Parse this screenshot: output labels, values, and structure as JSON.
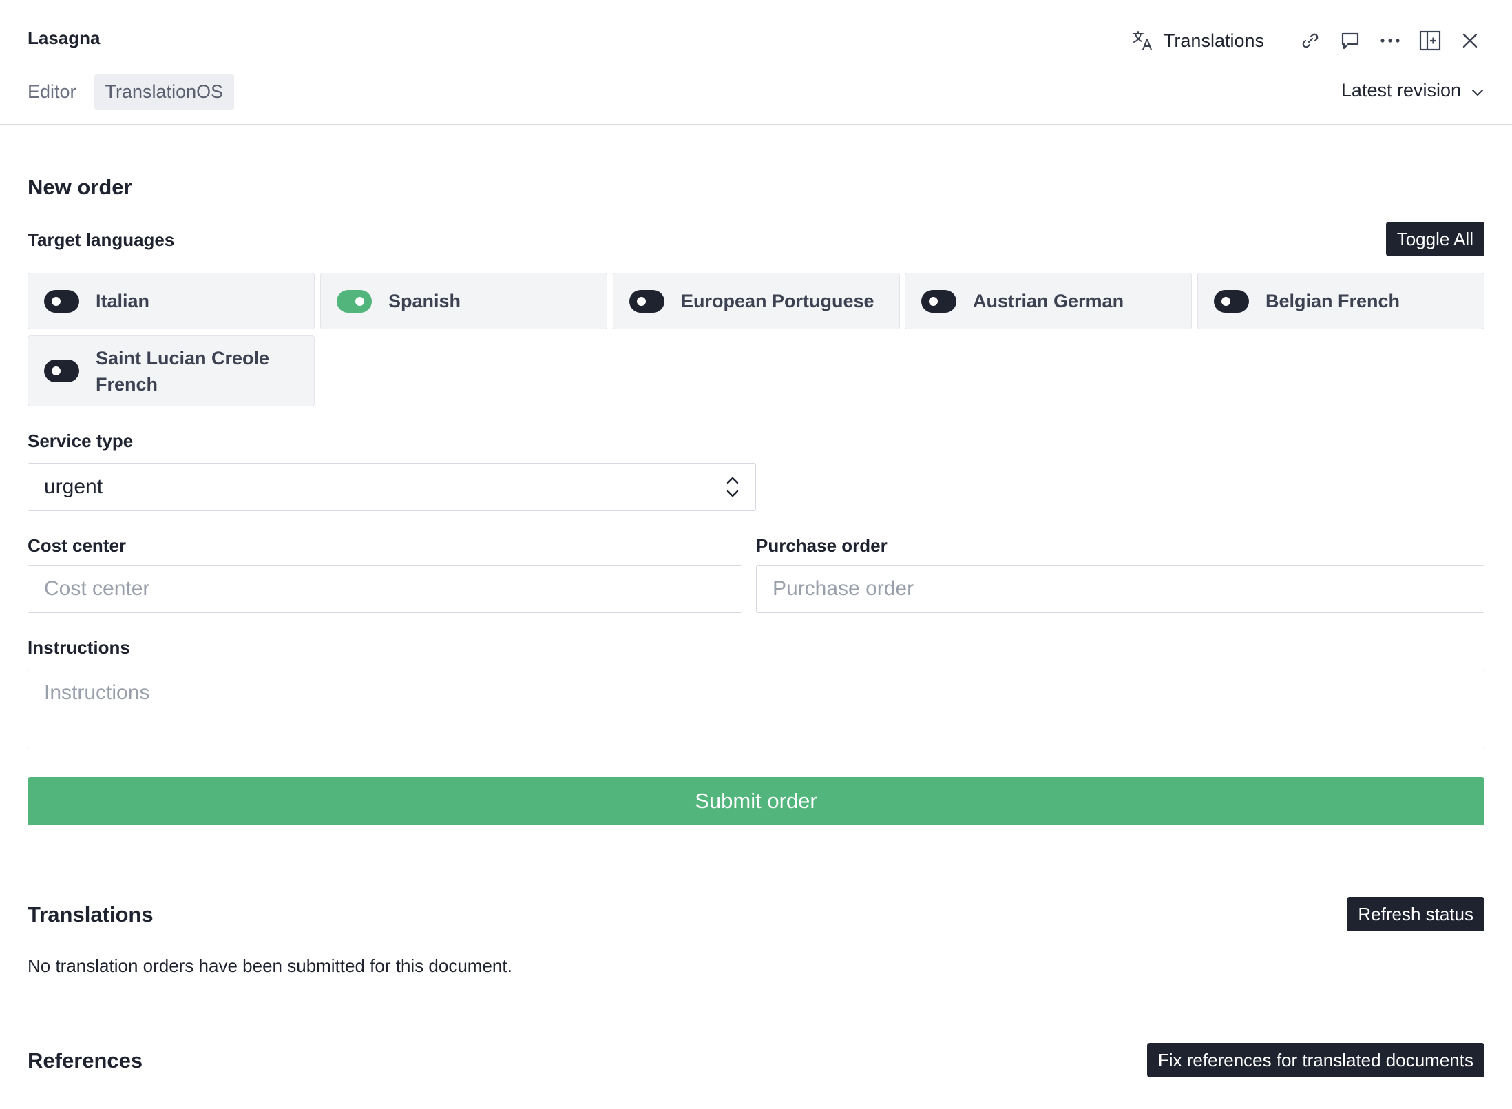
{
  "header": {
    "title": "Lasagna",
    "translations_label": "Translations",
    "icons": [
      "translate-icon",
      "link-icon",
      "comment-icon",
      "more-icon",
      "split-pane-icon",
      "close-icon"
    ],
    "tabs": [
      {
        "label": "Editor",
        "active": false
      },
      {
        "label": "TranslationOS",
        "active": true
      }
    ],
    "revision_label": "Latest revision"
  },
  "order": {
    "title": "New order",
    "target_languages_label": "Target languages",
    "toggle_all_label": "Toggle All",
    "languages": [
      {
        "name": "Italian",
        "enabled": false
      },
      {
        "name": "Spanish",
        "enabled": true
      },
      {
        "name": "European Portuguese",
        "enabled": false
      },
      {
        "name": "Austrian German",
        "enabled": false
      },
      {
        "name": "Belgian French",
        "enabled": false
      },
      {
        "name": "Saint Lucian Creole French",
        "enabled": false
      }
    ],
    "service_type_label": "Service type",
    "service_type_value": "urgent",
    "cost_center_label": "Cost center",
    "cost_center_placeholder": "Cost center",
    "purchase_order_label": "Purchase order",
    "purchase_order_placeholder": "Purchase order",
    "instructions_label": "Instructions",
    "instructions_placeholder": "Instructions",
    "submit_label": "Submit order"
  },
  "translations": {
    "title": "Translations",
    "refresh_label": "Refresh status",
    "empty_text": "No translation orders have been submitted for this document."
  },
  "references": {
    "title": "References",
    "fix_label": "Fix references for translated documents"
  },
  "colors": {
    "accent_green": "#52b57c",
    "dark": "#1f2330"
  }
}
